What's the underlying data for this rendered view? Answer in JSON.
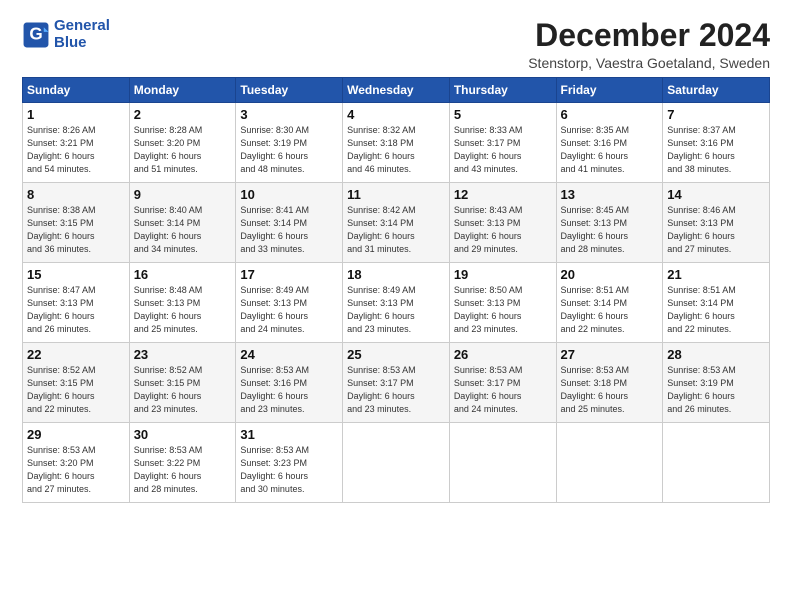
{
  "logo": {
    "line1": "General",
    "line2": "Blue"
  },
  "title": "December 2024",
  "subtitle": "Stenstorp, Vaestra Goetaland, Sweden",
  "headers": [
    "Sunday",
    "Monday",
    "Tuesday",
    "Wednesday",
    "Thursday",
    "Friday",
    "Saturday"
  ],
  "weeks": [
    [
      {
        "day": "1",
        "info": "Sunrise: 8:26 AM\nSunset: 3:21 PM\nDaylight: 6 hours\nand 54 minutes."
      },
      {
        "day": "2",
        "info": "Sunrise: 8:28 AM\nSunset: 3:20 PM\nDaylight: 6 hours\nand 51 minutes."
      },
      {
        "day": "3",
        "info": "Sunrise: 8:30 AM\nSunset: 3:19 PM\nDaylight: 6 hours\nand 48 minutes."
      },
      {
        "day": "4",
        "info": "Sunrise: 8:32 AM\nSunset: 3:18 PM\nDaylight: 6 hours\nand 46 minutes."
      },
      {
        "day": "5",
        "info": "Sunrise: 8:33 AM\nSunset: 3:17 PM\nDaylight: 6 hours\nand 43 minutes."
      },
      {
        "day": "6",
        "info": "Sunrise: 8:35 AM\nSunset: 3:16 PM\nDaylight: 6 hours\nand 41 minutes."
      },
      {
        "day": "7",
        "info": "Sunrise: 8:37 AM\nSunset: 3:16 PM\nDaylight: 6 hours\nand 38 minutes."
      }
    ],
    [
      {
        "day": "8",
        "info": "Sunrise: 8:38 AM\nSunset: 3:15 PM\nDaylight: 6 hours\nand 36 minutes."
      },
      {
        "day": "9",
        "info": "Sunrise: 8:40 AM\nSunset: 3:14 PM\nDaylight: 6 hours\nand 34 minutes."
      },
      {
        "day": "10",
        "info": "Sunrise: 8:41 AM\nSunset: 3:14 PM\nDaylight: 6 hours\nand 33 minutes."
      },
      {
        "day": "11",
        "info": "Sunrise: 8:42 AM\nSunset: 3:14 PM\nDaylight: 6 hours\nand 31 minutes."
      },
      {
        "day": "12",
        "info": "Sunrise: 8:43 AM\nSunset: 3:13 PM\nDaylight: 6 hours\nand 29 minutes."
      },
      {
        "day": "13",
        "info": "Sunrise: 8:45 AM\nSunset: 3:13 PM\nDaylight: 6 hours\nand 28 minutes."
      },
      {
        "day": "14",
        "info": "Sunrise: 8:46 AM\nSunset: 3:13 PM\nDaylight: 6 hours\nand 27 minutes."
      }
    ],
    [
      {
        "day": "15",
        "info": "Sunrise: 8:47 AM\nSunset: 3:13 PM\nDaylight: 6 hours\nand 26 minutes."
      },
      {
        "day": "16",
        "info": "Sunrise: 8:48 AM\nSunset: 3:13 PM\nDaylight: 6 hours\nand 25 minutes."
      },
      {
        "day": "17",
        "info": "Sunrise: 8:49 AM\nSunset: 3:13 PM\nDaylight: 6 hours\nand 24 minutes."
      },
      {
        "day": "18",
        "info": "Sunrise: 8:49 AM\nSunset: 3:13 PM\nDaylight: 6 hours\nand 23 minutes."
      },
      {
        "day": "19",
        "info": "Sunrise: 8:50 AM\nSunset: 3:13 PM\nDaylight: 6 hours\nand 23 minutes."
      },
      {
        "day": "20",
        "info": "Sunrise: 8:51 AM\nSunset: 3:14 PM\nDaylight: 6 hours\nand 22 minutes."
      },
      {
        "day": "21",
        "info": "Sunrise: 8:51 AM\nSunset: 3:14 PM\nDaylight: 6 hours\nand 22 minutes."
      }
    ],
    [
      {
        "day": "22",
        "info": "Sunrise: 8:52 AM\nSunset: 3:15 PM\nDaylight: 6 hours\nand 22 minutes."
      },
      {
        "day": "23",
        "info": "Sunrise: 8:52 AM\nSunset: 3:15 PM\nDaylight: 6 hours\nand 23 minutes."
      },
      {
        "day": "24",
        "info": "Sunrise: 8:53 AM\nSunset: 3:16 PM\nDaylight: 6 hours\nand 23 minutes."
      },
      {
        "day": "25",
        "info": "Sunrise: 8:53 AM\nSunset: 3:17 PM\nDaylight: 6 hours\nand 23 minutes."
      },
      {
        "day": "26",
        "info": "Sunrise: 8:53 AM\nSunset: 3:17 PM\nDaylight: 6 hours\nand 24 minutes."
      },
      {
        "day": "27",
        "info": "Sunrise: 8:53 AM\nSunset: 3:18 PM\nDaylight: 6 hours\nand 25 minutes."
      },
      {
        "day": "28",
        "info": "Sunrise: 8:53 AM\nSunset: 3:19 PM\nDaylight: 6 hours\nand 26 minutes."
      }
    ],
    [
      {
        "day": "29",
        "info": "Sunrise: 8:53 AM\nSunset: 3:20 PM\nDaylight: 6 hours\nand 27 minutes."
      },
      {
        "day": "30",
        "info": "Sunrise: 8:53 AM\nSunset: 3:22 PM\nDaylight: 6 hours\nand 28 minutes."
      },
      {
        "day": "31",
        "info": "Sunrise: 8:53 AM\nSunset: 3:23 PM\nDaylight: 6 hours\nand 30 minutes."
      },
      {
        "day": "",
        "info": ""
      },
      {
        "day": "",
        "info": ""
      },
      {
        "day": "",
        "info": ""
      },
      {
        "day": "",
        "info": ""
      }
    ]
  ]
}
